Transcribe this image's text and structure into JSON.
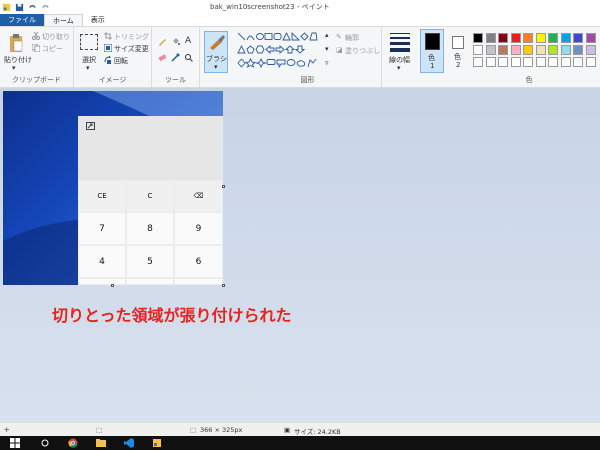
{
  "window": {
    "title": "bak_win10screenshot23 - ペイント"
  },
  "tabs": [
    {
      "label": "ファイル"
    },
    {
      "label": "ホーム"
    },
    {
      "label": "表示"
    }
  ],
  "clipboard": {
    "paste_label": "貼り付け",
    "cut_label": "切り取り",
    "copy_label": "コピー",
    "group_label": "クリップボード"
  },
  "image": {
    "select_label": "選択",
    "crop_label": "トリミング",
    "resize_label": "サイズ変更",
    "rotate_label": "回転",
    "group_label": "イメージ"
  },
  "tools": {
    "text_tool": "A",
    "group_label": "ツール"
  },
  "brush": {
    "label": "ブラシ"
  },
  "shapes": {
    "outline_label": "輪郭",
    "fill_label": "塗りつぶし",
    "group_label": "図形"
  },
  "size": {
    "label": "線の幅"
  },
  "colors": {
    "color1_label": "色",
    "color1_num": "1",
    "color2_label": "色",
    "color2_num": "2",
    "group_label": "色",
    "color1": "#000000",
    "color2": "#ffffff",
    "palette_row1": [
      "#000000",
      "#7f7f7f",
      "#880015",
      "#ed1c24",
      "#ff7f27",
      "#fff200",
      "#22b14c",
      "#00a2e8",
      "#3f48cc",
      "#a349a4"
    ],
    "palette_row2": [
      "#ffffff",
      "#c3c3c3",
      "#b97a57",
      "#ffaec9",
      "#ffc90e",
      "#efe4b0",
      "#b5e61d",
      "#99d9ea",
      "#7092be",
      "#c8bfe7"
    ],
    "palette_row3": [
      "#ffffff",
      "#ffffff",
      "#ffffff",
      "#ffffff",
      "#ffffff",
      "#ffffff",
      "#ffffff",
      "#ffffff",
      "#ffffff",
      "#ffffff"
    ]
  },
  "calculator": {
    "ce_label": "CE",
    "c_label": "C",
    "backspace_icon": "⌫",
    "row1": [
      "7",
      "8",
      "9"
    ],
    "row2": [
      "4",
      "5",
      "6"
    ]
  },
  "annotation": {
    "text": "切りとった領域が張り付けられた"
  },
  "status": {
    "position": "",
    "selection_size": "366 × 325px",
    "file_size": "サイズ: 24.2KB"
  }
}
